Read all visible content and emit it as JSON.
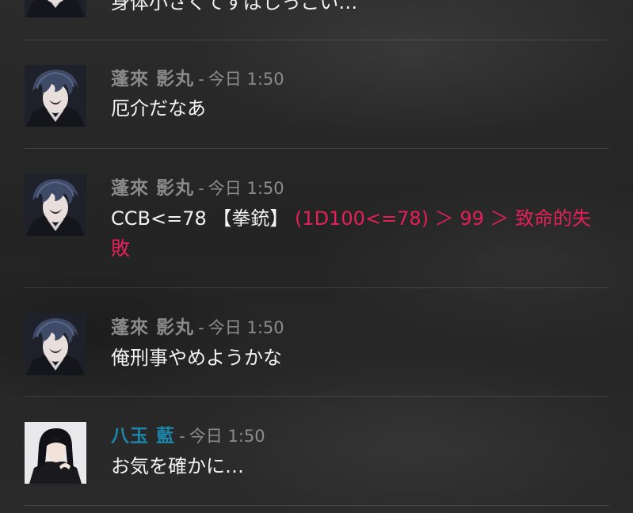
{
  "messages": [
    {
      "id": "m0",
      "body": "身体小さくてすばしっこい…"
    },
    {
      "id": "m1",
      "name": "蓬來 影丸",
      "separator": "-",
      "time": "今日 1:50",
      "body": "厄介だなあ"
    },
    {
      "id": "m2",
      "name": "蓬來 影丸",
      "separator": "-",
      "time": "今日 1:50",
      "body_plain": "CCB<=78 【拳銃】",
      "body_dice": "(1D100<=78) ＞ 99 ＞ 致命的失敗"
    },
    {
      "id": "m3",
      "name": "蓬來 影丸",
      "separator": "-",
      "time": "今日 1:50",
      "body": "俺刑事やめようかな"
    },
    {
      "id": "m4",
      "name": "八玉 藍",
      "separator": "-",
      "time": "今日 1:50",
      "body": "お気を確かに…"
    }
  ],
  "colors": {
    "background": "#262626",
    "name_default": "#8a8a8a",
    "name_accent": "#1d86a8",
    "dice_result": "#e3205a",
    "body_text": "#f2f2f2"
  }
}
